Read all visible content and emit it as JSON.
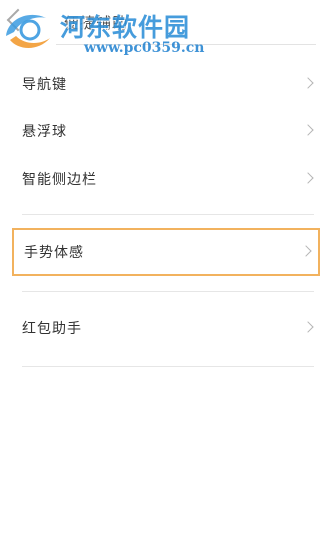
{
  "header": {
    "title": "便捷辅助"
  },
  "watermark": {
    "title": "河东软件园",
    "url": "www.pc0359.cn"
  },
  "list": {
    "items": [
      {
        "label": "导航键"
      },
      {
        "label": "悬浮球"
      },
      {
        "label": "智能侧边栏"
      },
      {
        "label": "手势体感",
        "selected": true
      },
      {
        "label": "红包助手"
      }
    ]
  },
  "colors": {
    "watermark_blue": "#2d8fd8",
    "selection_border": "#f2b25e",
    "divider": "#e6e6e6"
  }
}
